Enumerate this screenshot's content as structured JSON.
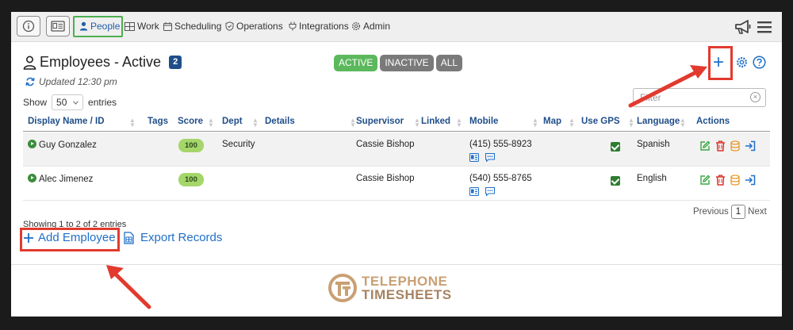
{
  "nav": {
    "items": [
      {
        "label": "People",
        "icon": "person-icon"
      },
      {
        "label": "Work",
        "icon": "grid-icon"
      },
      {
        "label": "Scheduling",
        "icon": "calendar-icon"
      },
      {
        "label": "Operations",
        "icon": "shield-icon"
      },
      {
        "label": "Integrations",
        "icon": "plug-icon"
      },
      {
        "label": "Admin",
        "icon": "gear-icon"
      }
    ]
  },
  "header": {
    "title": "Employees - Active",
    "count": "2",
    "updated": "Updated 12:30 pm",
    "filters": [
      "ACTIVE",
      "INACTIVE",
      "ALL"
    ]
  },
  "controls": {
    "show_label": "Show",
    "page_size": "50",
    "entries_label": "entries",
    "filter_placeholder": "Filter"
  },
  "table": {
    "columns": [
      "Display Name / ID",
      "Tags",
      "Score",
      "Dept",
      "Details",
      "Supervisor",
      "Linked",
      "Mobile",
      "Map",
      "Use GPS",
      "Language",
      "Actions"
    ],
    "rows": [
      {
        "name": "Guy Gonzalez",
        "score": "100",
        "dept": "Security",
        "supervisor": "Cassie Bishop",
        "mobile": "(415) 555-8923",
        "gps": true,
        "language": "Spanish"
      },
      {
        "name": "Alec Jimenez",
        "score": "100",
        "dept": "",
        "supervisor": "Cassie Bishop",
        "mobile": "(540) 555-8765",
        "gps": true,
        "language": "English"
      }
    ]
  },
  "footer_info": {
    "showing": "Showing 1 to 2 of 2 entries",
    "previous": "Previous",
    "page": "1",
    "next": "Next"
  },
  "links": {
    "add": "Add Employee",
    "export": "Export Records"
  },
  "logo": {
    "line1": "TELEPHONE",
    "line2": "TIMESHEETS"
  },
  "colors": {
    "accent": "#1f6fc9",
    "active": "#5cb85c",
    "annotation": "#e23a2e",
    "highlight": "#4caf50"
  }
}
